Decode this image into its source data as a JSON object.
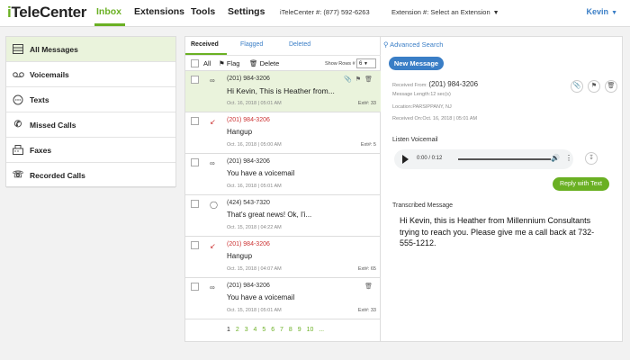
{
  "header": {
    "logo_i": "i",
    "logo_rest": "TeleCenter",
    "nav": [
      "Inbox",
      "Extensions",
      "Tools",
      "Settings"
    ],
    "account": "iTeleCenter #: (877) 592-6263",
    "extension": "Extension #: Select an Extension",
    "user": "Kevin"
  },
  "sidebar": {
    "items": [
      {
        "label": "All Messages",
        "icon": "mailbox-icon"
      },
      {
        "label": "Voicemails",
        "icon": "voicemail-icon"
      },
      {
        "label": "Texts",
        "icon": "chat-icon"
      },
      {
        "label": "Missed Calls",
        "icon": "phone-icon"
      },
      {
        "label": "Faxes",
        "icon": "fax-icon"
      },
      {
        "label": "Recorded Calls",
        "icon": "recorded-call-icon"
      }
    ]
  },
  "tabs": {
    "received": "Received",
    "flagged": "Flagged",
    "deleted": "Deleted"
  },
  "toolbar": {
    "all": "All",
    "flag": "Flag",
    "delete": "Delete",
    "rows_label": "Show Rows #",
    "rows_value": "6"
  },
  "messages": [
    {
      "type": "voicemail",
      "phone": "(201) 984-3206",
      "text": "Hi Kevin, This is Heather from...",
      "date": "Oct. 16, 2018 | 05:01 AM",
      "ext": "Ext#: 33"
    },
    {
      "type": "missed",
      "phone": "(201) 984-3206",
      "text": "Hangup",
      "date": "Oct. 16, 2018 | 05:00 AM",
      "ext": "Ext#: 5"
    },
    {
      "type": "voicemail",
      "phone": "(201) 984-3206",
      "text": "You have a voicemail",
      "date": "Oct. 16, 2018 | 05:01 AM",
      "ext": ""
    },
    {
      "type": "text",
      "phone": "(424) 543-7320",
      "text": "That's great news! Ok, I'i...",
      "date": "Oct. 15, 2018 | 04:22 AM",
      "ext": ""
    },
    {
      "type": "missed",
      "phone": "(201) 984-3206",
      "text": "Hangup",
      "date": "Oct. 15, 2018 | 04:07 AM",
      "ext": "Ext#: 65"
    },
    {
      "type": "voicemail",
      "phone": "(201) 984-3206",
      "text": "You have a voicemail",
      "date": "Oct. 15, 2018 | 05:01 AM",
      "ext": "Ext#: 33"
    }
  ],
  "pager": {
    "current": "1",
    "pages": "2 3 4 5 6 7 8 9 10 ..."
  },
  "detail": {
    "advanced_search": "Advanced Search",
    "new_message": "New Message",
    "received_from_label": "Received From:",
    "received_from": "(201) 984-3206",
    "length": "Message Length:12 sec(s)",
    "location": "Location:PARSIPPANY, NJ",
    "received_on": "Received On:Oct. 16, 2018 | 05:01 AM",
    "listen": "Listen Voicemail",
    "time": "0:00 / 0:12",
    "reply": "Reply with Text",
    "transcribed_title": "Transcribed Message",
    "transcript": "Hi Kevin, this is Heather from Millennium Consultants trying to reach you. Please give me a call back at 732-555-1212."
  }
}
